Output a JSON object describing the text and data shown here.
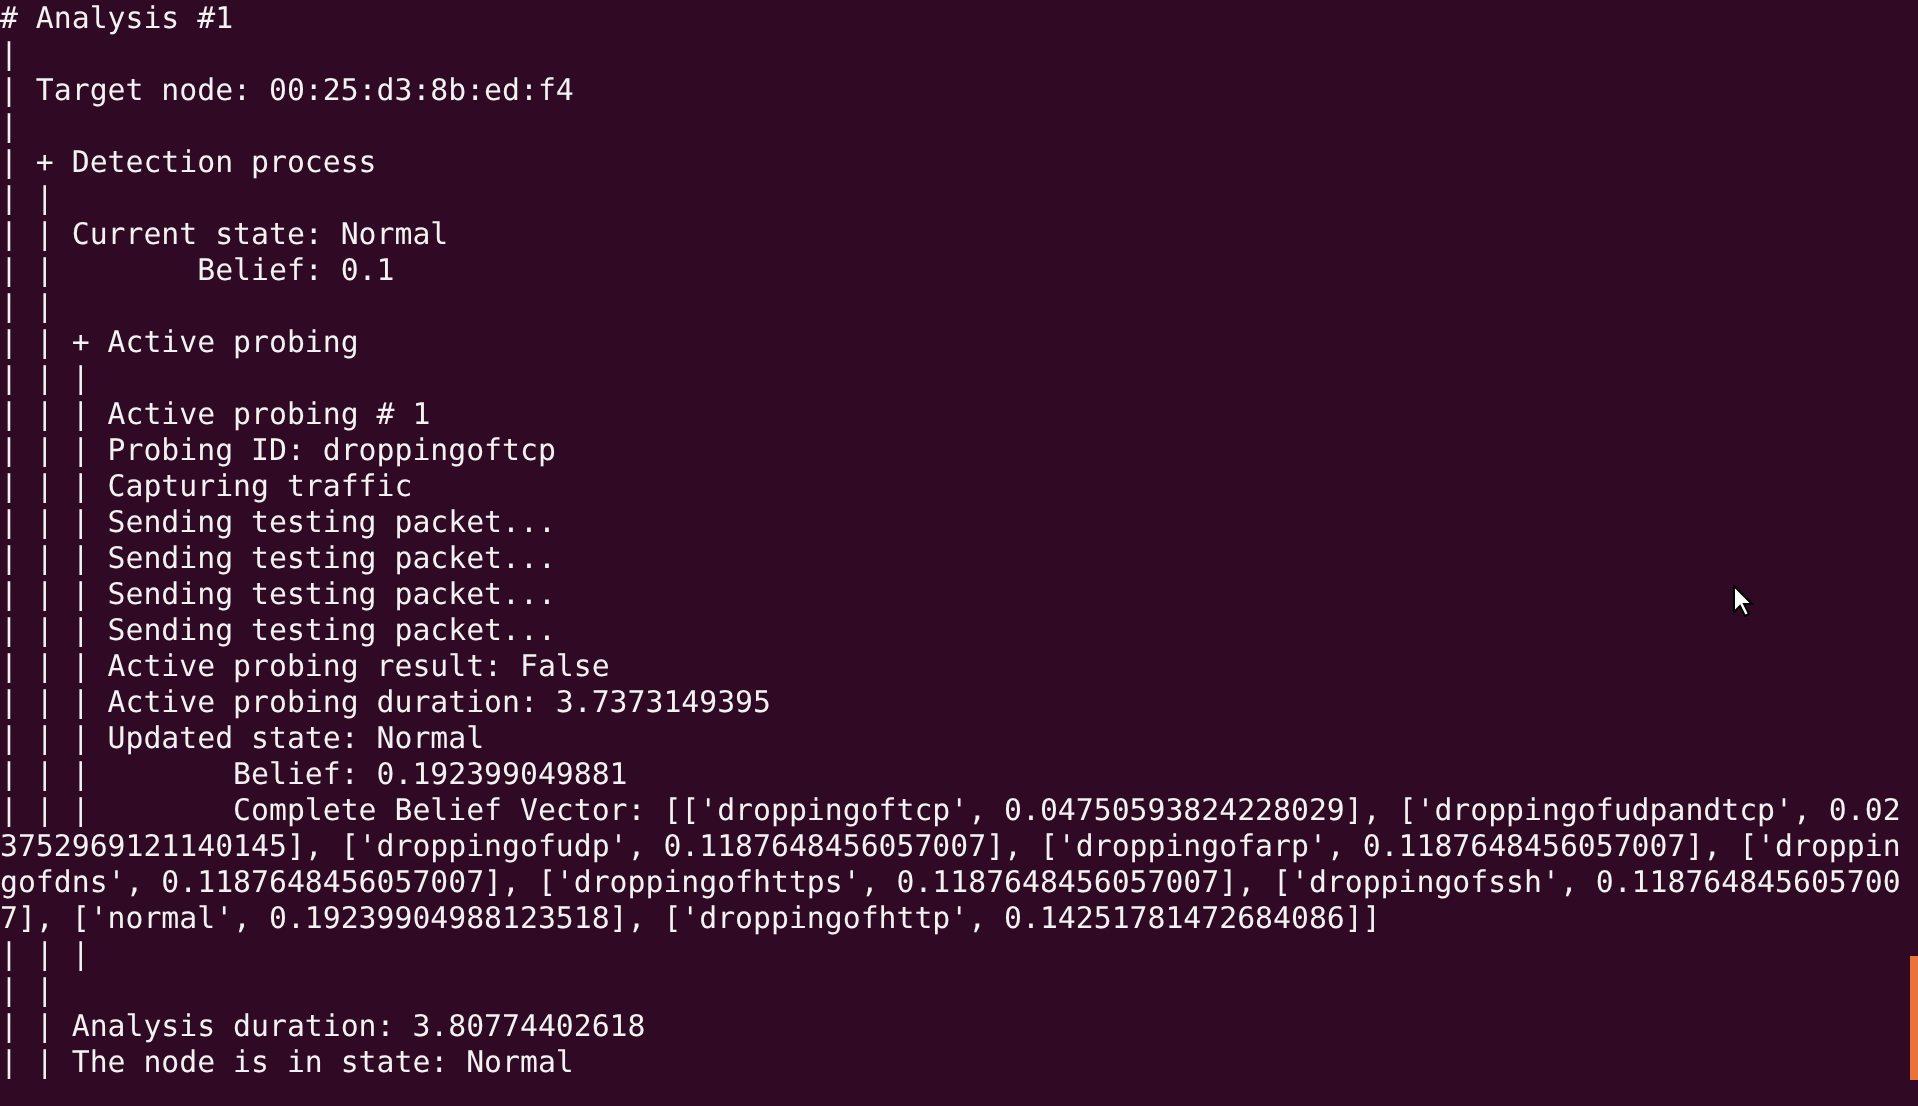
{
  "terminal": {
    "lines": [
      "# Analysis #1",
      "|",
      "| Target node: 00:25:d3:8b:ed:f4",
      "|",
      "| + Detection process",
      "| |",
      "| | Current state: Normal",
      "| |        Belief: 0.1",
      "| |",
      "| | + Active probing",
      "| | |",
      "| | | Active probing # 1",
      "| | | Probing ID: droppingoftcp",
      "| | | Capturing traffic",
      "| | | Sending testing packet...",
      "| | | Sending testing packet...",
      "| | | Sending testing packet...",
      "| | | Sending testing packet...",
      "| | | Active probing result: False",
      "| | | Active probing duration: 3.7373149395",
      "| | | Updated state: Normal",
      "| | |        Belief: 0.192399049881",
      "| | |        Complete Belief Vector: [['droppingoftcp', 0.04750593824228029], ['droppingofudpandtcp', 0.02",
      "3752969121140145], ['droppingofudp', 0.1187648456057007], ['droppingofarp', 0.1187648456057007], ['droppin",
      "gofdns', 0.1187648456057007], ['droppingofhttps', 0.1187648456057007], ['droppingofssh', 0.118764845605700",
      "7], ['normal', 0.19239904988123518], ['droppingofhttp', 0.14251781472684086]]",
      "| | |",
      "| |",
      "| | Analysis duration: 3.80774402618",
      "| | The node is in state: Normal"
    ]
  }
}
